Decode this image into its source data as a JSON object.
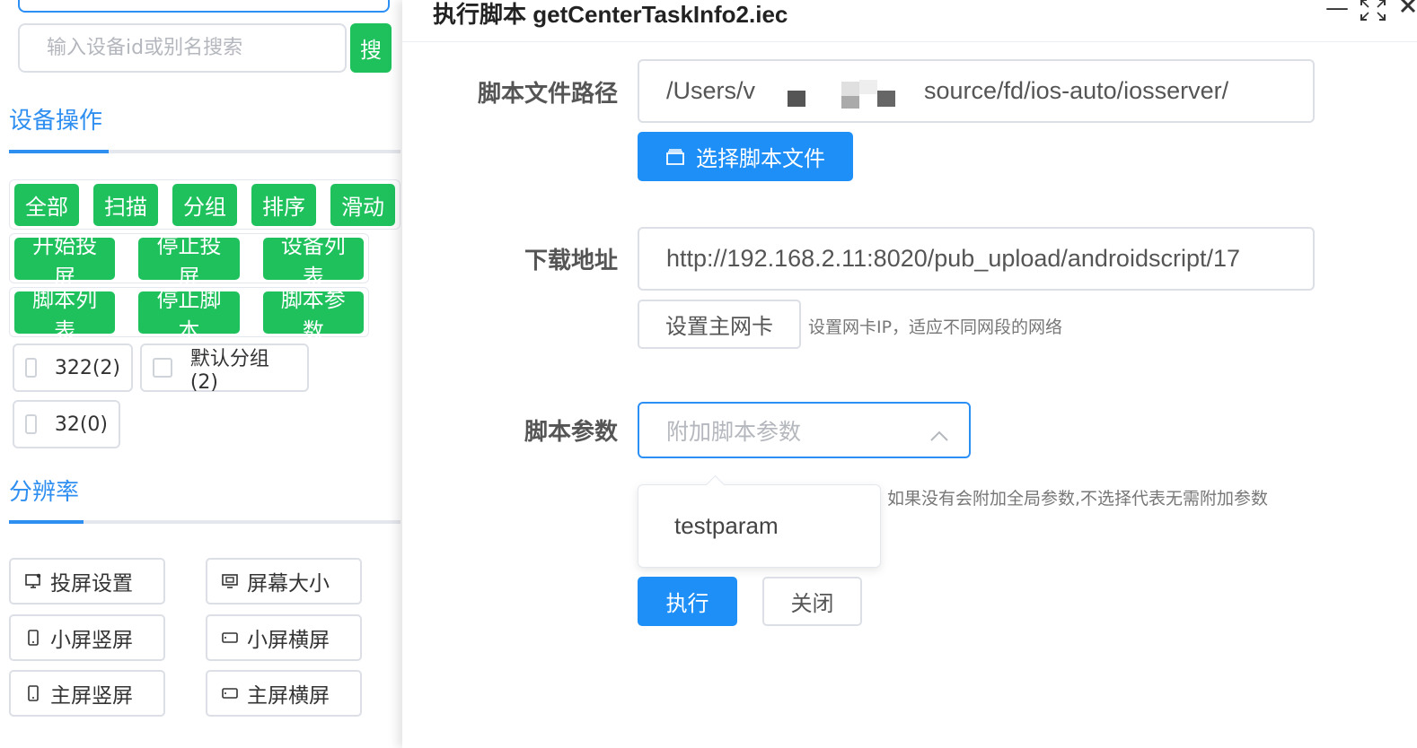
{
  "left": {
    "search_placeholder": "输入设备id或别名搜索",
    "search_button": "搜",
    "device_ops_title": "设备操作",
    "row1": [
      "全部",
      "扫描",
      "分组",
      "排序",
      "滑动"
    ],
    "row2": [
      "开始投屏",
      "停止投屏",
      "设备列表"
    ],
    "row3": [
      "脚本列表",
      "停止脚本",
      "脚本参数"
    ],
    "groups": [
      "322(2)",
      "默认分组(2)",
      "32(0)"
    ],
    "resolution_title": "分辨率",
    "screen_buttons": [
      {
        "label": "投屏设置",
        "icon": "monitor-settings-icon"
      },
      {
        "label": "屏幕大小",
        "icon": "screen-size-icon"
      },
      {
        "label": "小屏竖屏",
        "icon": "portrait-icon"
      },
      {
        "label": "小屏横屏",
        "icon": "landscape-icon"
      },
      {
        "label": "主屏竖屏",
        "icon": "portrait-icon"
      },
      {
        "label": "主屏横屏",
        "icon": "landscape-icon"
      }
    ],
    "accent_color": "#2f8ff0",
    "green_color": "#1fc15d"
  },
  "dialog": {
    "title": "执行脚本 getCenterTaskInfo2.iec",
    "window_controls": [
      "—",
      "⛶"
    ],
    "script_path_label": "脚本文件路径",
    "script_path_left": "/Users/v",
    "script_path_right": "source/fd/ios-auto/iosserver/",
    "choose_file_button": "选择脚本文件",
    "download_label": "下载地址",
    "download_value": "http://192.168.2.11:8020/pub_upload/androidscript/17",
    "set_nic_button": "设置主网卡",
    "set_nic_hint": "设置网卡IP，适应不同网段的网络",
    "params_label": "脚本参数",
    "params_placeholder": "附加脚本参数",
    "params_options": [
      "testparam"
    ],
    "params_hint": "如果没有会附加全局参数,不选择代表无需附加参数",
    "execute_button": "执行",
    "close_button": "关闭",
    "primary_color": "#1e8ff7"
  }
}
